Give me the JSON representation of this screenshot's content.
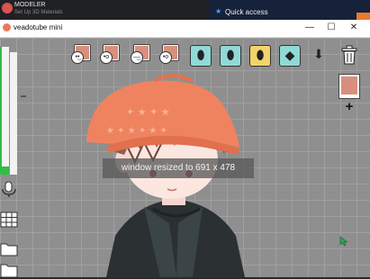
{
  "taskbar": {
    "app_title": "MODELER",
    "app_subtitle": "Set Up 3D Materials",
    "quick_access_label": "Quick access",
    "quick_access_icon": "star-icon"
  },
  "window": {
    "title": "veadotube mini",
    "minimize_glyph": "—",
    "maximize_glyph": "☐",
    "close_glyph": "✕"
  },
  "toolbar": {
    "states": [
      {
        "name": "state-1",
        "face": "•͜•"
      },
      {
        "name": "state-2",
        "face": "•o"
      },
      {
        "name": "state-3",
        "face": "–͜–"
      },
      {
        "name": "state-4",
        "face": "•o"
      }
    ],
    "tools": [
      {
        "name": "avatar-hop-tool",
        "color": "#8fdad6",
        "glyph": "⬮"
      },
      {
        "name": "avatar-shake-tool",
        "color": "#8fdad6",
        "glyph": "⬮"
      },
      {
        "name": "avatar-highlight-tool",
        "color": "#f3d46a",
        "glyph": "⬮"
      },
      {
        "name": "hotkey-tool",
        "color": "#8fdad6",
        "glyph": "◆"
      },
      {
        "name": "import-tool",
        "color": "#ffffff",
        "glyph": "⬇"
      }
    ],
    "delete_icon": "trash-icon",
    "add_glyph": "+"
  },
  "meter": {
    "level": 0.06,
    "threshold": 0.65
  },
  "toast": {
    "text": "window resized to 691 x 478"
  }
}
